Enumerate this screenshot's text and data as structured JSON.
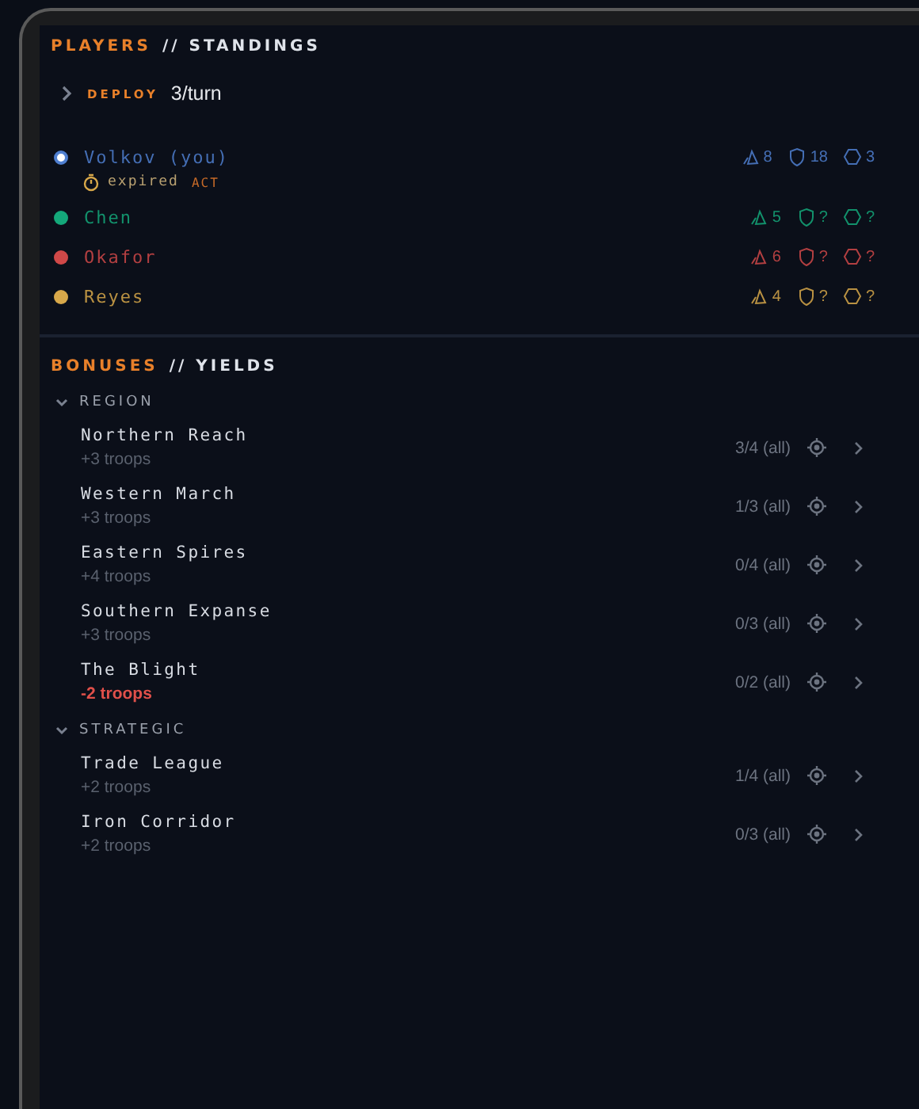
{
  "players_panel": {
    "title_accent": "PLAYERS",
    "title_rest": "// STANDINGS",
    "deploy": {
      "expanded": false,
      "label": "DEPLOY",
      "value": "3/turn"
    },
    "players": [
      {
        "name": "Volkov (you)",
        "color": "#4f7fd0",
        "current": true,
        "timer": {
          "label": "expired",
          "badge": "ACT"
        },
        "troops": "8",
        "defense": "18",
        "territories": "3"
      },
      {
        "name": "Chen",
        "color": "#14a87a",
        "current": false,
        "troops": "5",
        "defense": "?",
        "territories": "?"
      },
      {
        "name": "Okafor",
        "color": "#d04848",
        "current": false,
        "troops": "6",
        "defense": "?",
        "territories": "?"
      },
      {
        "name": "Reyes",
        "color": "#d8a84a",
        "current": false,
        "troops": "4",
        "defense": "?",
        "territories": "?"
      }
    ]
  },
  "bonuses_panel": {
    "title_accent": "BONUSES",
    "title_rest": "// YIELDS",
    "groups": [
      {
        "title": "REGION",
        "expanded": true,
        "items": [
          {
            "name": "Northern Reach",
            "yield": "+3 troops",
            "negative": false,
            "progress": "3/4 (all)"
          },
          {
            "name": "Western March",
            "yield": "+3 troops",
            "negative": false,
            "progress": "1/3 (all)"
          },
          {
            "name": "Eastern Spires",
            "yield": "+4 troops",
            "negative": false,
            "progress": "0/4 (all)"
          },
          {
            "name": "Southern Expanse",
            "yield": "+3 troops",
            "negative": false,
            "progress": "0/3 (all)"
          },
          {
            "name": "The Blight",
            "yield": "-2 troops",
            "negative": true,
            "progress": "0/2 (all)"
          }
        ]
      },
      {
        "title": "STRATEGIC",
        "expanded": true,
        "items": [
          {
            "name": "Trade League",
            "yield": "+2 troops",
            "negative": false,
            "progress": "1/4 (all)"
          },
          {
            "name": "Iron Corridor",
            "yield": "+2 troops",
            "negative": false,
            "progress": "0/3 (all)"
          }
        ]
      }
    ]
  }
}
